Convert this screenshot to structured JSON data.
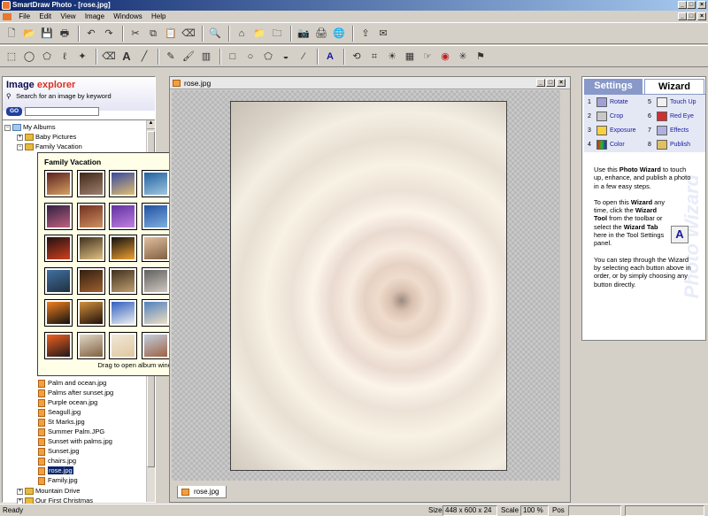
{
  "window": {
    "title": "SmartDraw Photo - [rose.jpg]"
  },
  "menu": [
    "File",
    "Edit",
    "View",
    "Image",
    "Windows",
    "Help"
  ],
  "explorer": {
    "title_a": "Image",
    "title_b": "explorer",
    "search_label": "Search for an image by keyword",
    "go_label": "GO",
    "search_value": ""
  },
  "tree": {
    "root": "My Albums",
    "baby": "Baby Pictures",
    "family": "Family Vacation",
    "files": [
      "Palm and ocean.jpg",
      "Palms after sunset.jpg",
      "Purple ocean.jpg",
      "Seagull.jpg",
      "St Marks.jpg",
      "Summer Palm.JPG",
      "Sunset with palms.jpg",
      "Sunset.jpg",
      "chairs.jpg",
      "rose.jpg",
      "Family.jpg"
    ],
    "mountain": "Mountain Drive",
    "christmas": "Our First Christmas"
  },
  "popup": {
    "title": "Family Vacation",
    "hint": "Drag to open album window"
  },
  "document": {
    "title": "rose.jpg",
    "tab": "rose.jpg"
  },
  "panel": {
    "tab_settings": "Settings",
    "tab_wizard": "Wizard",
    "steps": [
      {
        "n": "1",
        "label": "Rotate"
      },
      {
        "n": "2",
        "label": "Crop"
      },
      {
        "n": "3",
        "label": "Exposure"
      },
      {
        "n": "4",
        "label": "Color"
      },
      {
        "n": "5",
        "label": "Touch Up"
      },
      {
        "n": "6",
        "label": "Red Eye"
      },
      {
        "n": "7",
        "label": "Effects"
      },
      {
        "n": "8",
        "label": "Publish"
      }
    ],
    "p1": {
      "a": "Use this ",
      "b": "Photo Wizard",
      "c": " to touch up, enhance, and publish a photo in a few easy steps."
    },
    "p2": {
      "a": "To open this ",
      "b": "Wizard",
      "c": " any time, click the ",
      "d": "Wizard Tool",
      "e": " from the toolbar or select the ",
      "f": "Wizard Tab",
      "g": " here in the Tool Settings panel."
    },
    "p3": "You can step through the Wizard by selecting each button above in order, or by simply choosing any button directly.",
    "watermark": "Photo Wizard"
  },
  "status": {
    "ready": "Ready",
    "size_label": "Size",
    "size_value": "448 x 600 x 24",
    "scale_label": "Scale",
    "scale_value": "100 %",
    "pos_label": "Pos"
  },
  "colors": {
    "title_start": "#0a246a",
    "title_end": "#a6caf0",
    "accent_red": "#d83020",
    "selection": "#0a246a"
  }
}
